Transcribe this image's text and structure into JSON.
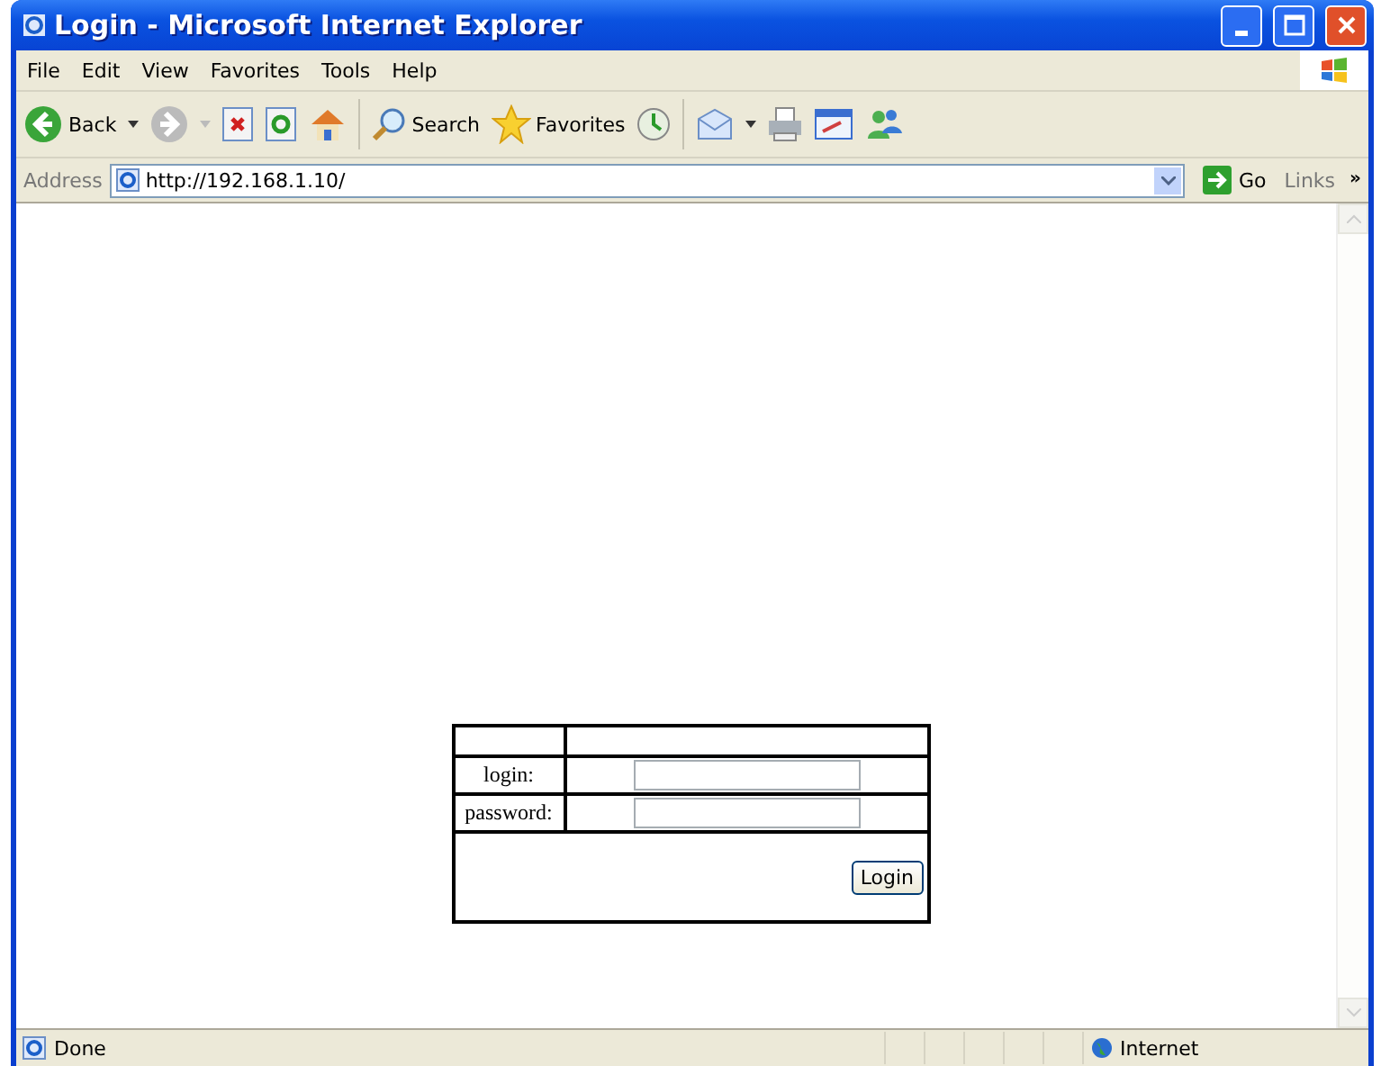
{
  "window": {
    "title": "Login - Microsoft Internet Explorer"
  },
  "menu": [
    "File",
    "Edit",
    "View",
    "Favorites",
    "Tools",
    "Help"
  ],
  "toolbar": {
    "back": "Back",
    "search": "Search",
    "favorites": "Favorites"
  },
  "address_bar": {
    "label": "Address",
    "url": "http://192.168.1.10/",
    "go": "Go",
    "links": "Links",
    "more": "»"
  },
  "form": {
    "rows": [
      {
        "label": "login:"
      },
      {
        "label": "password:"
      }
    ],
    "button": "Login"
  },
  "status_bar": {
    "text": "Done",
    "zone": "Internet"
  }
}
